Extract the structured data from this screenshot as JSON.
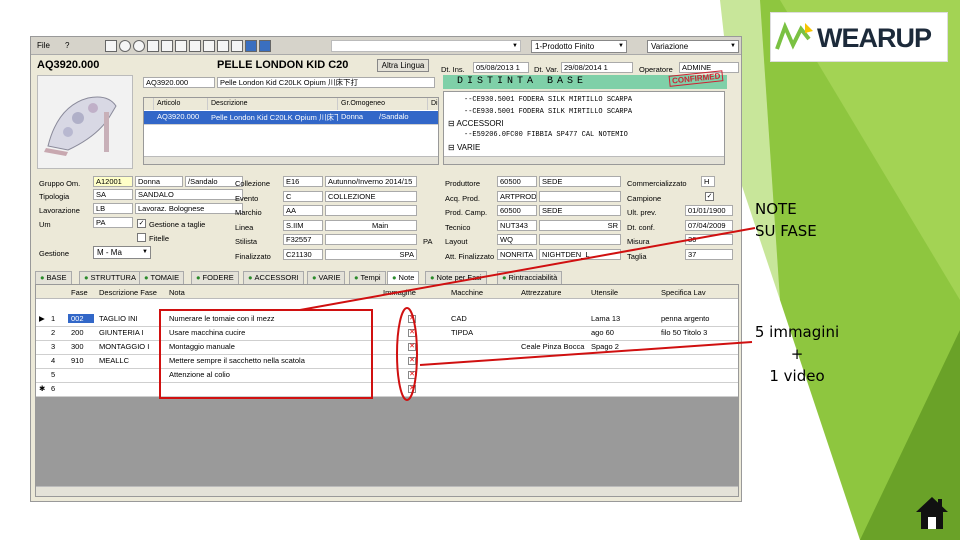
{
  "menu": {
    "file": "File",
    "help": "?"
  },
  "header_combo": {
    "product_type": "1-Prodotto Finito",
    "sequence": "Variazione"
  },
  "article": {
    "code": "AQ3920.000",
    "title": "PELLE LONDON KID C20",
    "alt_button": "Altra Lingua",
    "dt_ins_label": "Dt. Ins.",
    "dt_ins": "05/08/2013 1",
    "dt_var_label": "Dt. Var.",
    "dt_var": "29/08/2014 1",
    "operator_label": "Operatore",
    "operator": "ADMINE",
    "sub_code": "AQ3920.000",
    "sub_desc": "Pelle London Kid C20LK Opium 川床下打"
  },
  "distinta": {
    "title": "DISTINTA BASE",
    "stamp": "CONFIRMED",
    "lines": [
      "--CE930.5001        FODERA SILK MIRTILLO SCARPA",
      "--CE930.5001        FODERA SILK MIRTILLO SCARPA",
      "ACCESSORI",
      "--E59206.0FC00       FIBBIA SP477 CAL NOTEMIO",
      "VARIE"
    ]
  },
  "components": {
    "headers": [
      "Articolo",
      "Descrizione",
      "Gr.Omogeneo",
      "Di"
    ],
    "row": [
      "AQ3920.000",
      "Pelle London Kid C20LK Opium 川床下打",
      "Donna",
      "/Sandalo"
    ]
  },
  "form_left": {
    "labels": [
      "Gruppo Om.",
      "Tipologia",
      "Lavorazione",
      "Um",
      "Gestione"
    ],
    "values": [
      [
        "A12001",
        "Donna",
        "/Sandalo"
      ],
      [
        "SA",
        "SANDALO"
      ],
      [
        "LB",
        "Lavoraz. Bolognese"
      ],
      [
        "PA",
        ""
      ]
    ],
    "gestione": "M - Ma",
    "check1": "Gestione a taglie",
    "check2": "Fitelle"
  },
  "form_mid": {
    "labels": [
      "Collezione",
      "Evento",
      "Marchio",
      "Linea",
      "Stilista",
      "Finalizzato"
    ],
    "values": [
      [
        "E16",
        "Autunno/Inverno 2014/15"
      ],
      [
        "C",
        "COLLEZIONE"
      ],
      [
        "AA",
        ""
      ],
      [
        "S.IIM",
        "Main"
      ],
      [
        "F32557",
        ""
      ],
      [
        "C21130",
        "SPA"
      ]
    ],
    "pa": "PA"
  },
  "form_right": {
    "labels": [
      "Produttore",
      "Acq. Prod.",
      "Prod. Camp.",
      "Tecnico",
      "Layout",
      "Att. Finalizzato"
    ],
    "values": [
      [
        "60500",
        "SEDE"
      ],
      [
        "ARTPROD",
        ""
      ],
      [
        "60500",
        "SEDE"
      ],
      [
        "NUT343",
        "SR"
      ],
      [
        "WQ",
        ""
      ],
      [
        "NONRITA",
        "NIGHTDEN_L"
      ]
    ],
    "labels2": [
      "Commercializzato",
      "Campione",
      "Ult. prev.",
      "Dt. conf.",
      "Misura",
      "Taglia"
    ],
    "values2": [
      "H",
      "✓",
      "01/01/1900",
      "07/04/2009",
      "36",
      "37"
    ]
  },
  "tabs": [
    "BASE",
    "STRUTTURA",
    "TOMAIE",
    "FODERE",
    "ACCESSORI",
    "VARIE",
    "Tempi",
    "Note",
    "Note per Fasi",
    "Rintracciabilità"
  ],
  "notes_grid": {
    "headers": [
      "Fase",
      "Descrizione Fase",
      "Nota",
      "Immagine",
      "Macchine",
      "Attrezzature",
      "Utensile",
      "Specifica Lav"
    ],
    "rows": [
      {
        "marker": "▶",
        "num": "1",
        "fase": "002",
        "desc": "TAGLIO INI",
        "nota": "Numerare le tomaie con il mezz",
        "img": "✕",
        "macchine": "CAD",
        "attrezz": "",
        "utensile": "Lama 13",
        "spec": "penna argento"
      },
      {
        "marker": "",
        "num": "2",
        "fase": "200",
        "desc": "GIUNTERIA I",
        "nota": "Usare macchina cucire",
        "img": "✕",
        "macchine": "TIPDA",
        "attrezz": "",
        "utensile": "ago 60",
        "spec": "filo 50 Titolo 3"
      },
      {
        "marker": "",
        "num": "3",
        "fase": "300",
        "desc": "MONTAGGIO I",
        "nota": "Montaggio manuale",
        "img": "✕",
        "macchine": "",
        "attrezz": "Ceale Pinza Bocca",
        "utensile": "Spago 2",
        "spec": ""
      },
      {
        "marker": "",
        "num": "4",
        "fase": "910",
        "desc": "MEALLC",
        "nota": "Mettere sempre il sacchetto nella scatola",
        "img": "✕",
        "macchine": "",
        "attrezz": "",
        "utensile": "",
        "spec": ""
      },
      {
        "marker": "",
        "num": "5",
        "fase": "",
        "desc": "",
        "nota": "Attenzione al colio",
        "img": "✕",
        "macchine": "",
        "attrezz": "",
        "utensile": "",
        "spec": ""
      },
      {
        "marker": "✱",
        "num": "6",
        "fase": "",
        "desc": "",
        "nota": "",
        "img": "✕",
        "macchine": "",
        "attrezz": "",
        "utensile": "",
        "spec": ""
      }
    ]
  },
  "annotations": {
    "note_fase": "NOTE\nSU FASE",
    "images": "5 immagini\n+\n1 video"
  },
  "logo": {
    "text": "WEARUP"
  },
  "colors": {
    "green_bg": "#8ec63f",
    "green_dark": "#6aa228",
    "annotation_red": "#d01010",
    "selection_blue": "#3267c8",
    "distinta_bg": "#7fd0a8"
  }
}
